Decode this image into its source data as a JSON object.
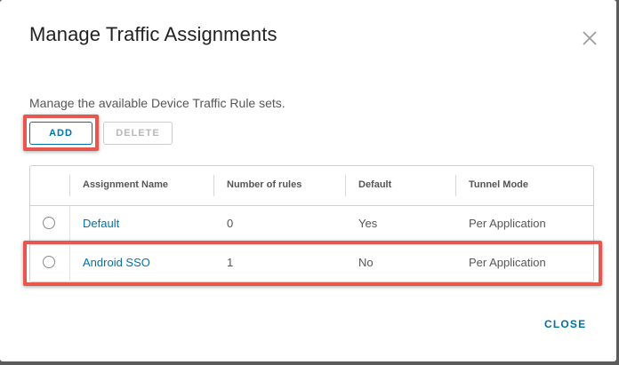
{
  "modal": {
    "title": "Manage Traffic Assignments",
    "description": "Manage the available Device Traffic Rule sets.",
    "close_label": "CLOSE"
  },
  "toolbar": {
    "add_label": "ADD",
    "delete_label": "DELETE"
  },
  "table": {
    "columns": [
      "Assignment Name",
      "Number of rules",
      "Default",
      "Tunnel Mode"
    ],
    "rows": [
      {
        "name": "Default",
        "rules": "0",
        "default": "Yes",
        "tunnel": "Per Application"
      },
      {
        "name": "Android SSO",
        "rules": "1",
        "default": "No",
        "tunnel": "Per Application"
      }
    ]
  },
  "colors": {
    "accent": "#0072a3",
    "highlight": "#e8574f",
    "backdrop": "#5b5b5b"
  }
}
